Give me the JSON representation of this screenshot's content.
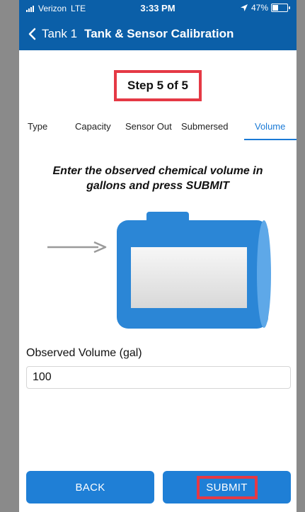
{
  "status_bar": {
    "carrier": "Verizon",
    "network": "LTE",
    "time": "3:33 PM",
    "battery_percent": "47%",
    "battery_level": 0.47
  },
  "nav": {
    "back_label": "Tank 1",
    "title": "Tank & Sensor Calibration"
  },
  "step": {
    "text": "Step 5 of 5"
  },
  "tabs": [
    {
      "label": "Type"
    },
    {
      "label": "Capacity"
    },
    {
      "label": "Sensor Out"
    },
    {
      "label": "Submersed"
    },
    {
      "label": "Volume",
      "active": true
    }
  ],
  "instructions": {
    "line1": "Enter the observed chemical volume in",
    "line2": "gallons and press SUBMIT"
  },
  "form": {
    "label": "Observed Volume (gal)",
    "value": "100"
  },
  "buttons": {
    "back": "BACK",
    "submit": "SUBMIT"
  },
  "colors": {
    "header": "#0b5fa8",
    "accent": "#1a7ad6",
    "button": "#1f7fd6",
    "highlight": "#e53945",
    "tank": "#2b86d6"
  },
  "icons": {
    "back": "chevron-left-icon",
    "arrow": "arrow-right-icon",
    "location": "location-arrow-icon",
    "battery": "battery-icon",
    "signal": "signal-icon"
  }
}
